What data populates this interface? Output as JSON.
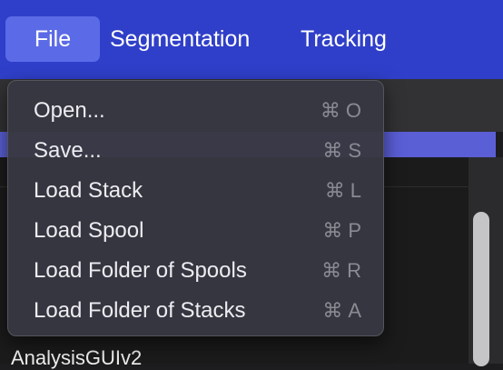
{
  "menubar": {
    "items": [
      {
        "label": "File"
      },
      {
        "label": "Segmentation"
      },
      {
        "label": "Tracking"
      }
    ]
  },
  "file_menu": {
    "items": [
      {
        "label": "Open...",
        "shortcut_key": "O"
      },
      {
        "label": "Save...",
        "shortcut_key": "S"
      },
      {
        "label": "Load Stack",
        "shortcut_key": "L"
      },
      {
        "label": "Load Spool",
        "shortcut_key": "P"
      },
      {
        "label": "Load Folder of Spools",
        "shortcut_key": "R"
      },
      {
        "label": "Load Folder of Stacks",
        "shortcut_key": "A"
      }
    ],
    "cmd_symbol": "⌘"
  },
  "background": {
    "window_label": "AnalysisGUIv2"
  },
  "colors": {
    "menubar": "#2f3fc9",
    "active_item": "#5b6ae6",
    "dropdown": "#383842",
    "accent_strip": "#5b5fd6"
  }
}
